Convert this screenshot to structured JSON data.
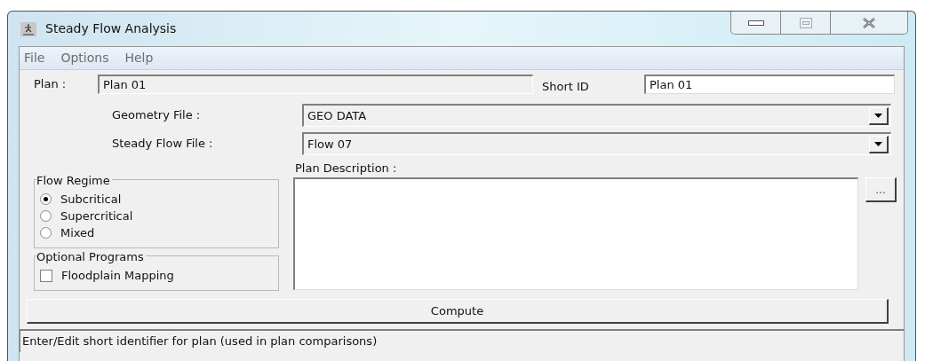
{
  "window": {
    "title": "Steady Flow Analysis"
  },
  "menu": [
    "File",
    "Options",
    "Help"
  ],
  "plan": {
    "label": "Plan :",
    "value": "Plan 01"
  },
  "short_id": {
    "label": "Short ID",
    "value": "Plan 01"
  },
  "geometry_file": {
    "label": "Geometry File :",
    "value": "GEO DATA"
  },
  "steady_flow_file": {
    "label": "Steady Flow File :",
    "value": "Flow 07"
  },
  "plan_description": {
    "label": "Plan Description :",
    "browse_button": "..."
  },
  "flow_regime": {
    "title": "Flow Regime",
    "options": [
      {
        "label": "Subcritical",
        "selected": true
      },
      {
        "label": "Supercritical",
        "selected": false
      },
      {
        "label": "Mixed",
        "selected": false
      }
    ]
  },
  "optional_programs": {
    "title": "Optional Programs",
    "items": [
      {
        "label": "Floodplain Mapping",
        "checked": false
      }
    ]
  },
  "compute_button": "Compute",
  "status_bar": "Enter/Edit short identifier for plan (used in plan comparisons)"
}
